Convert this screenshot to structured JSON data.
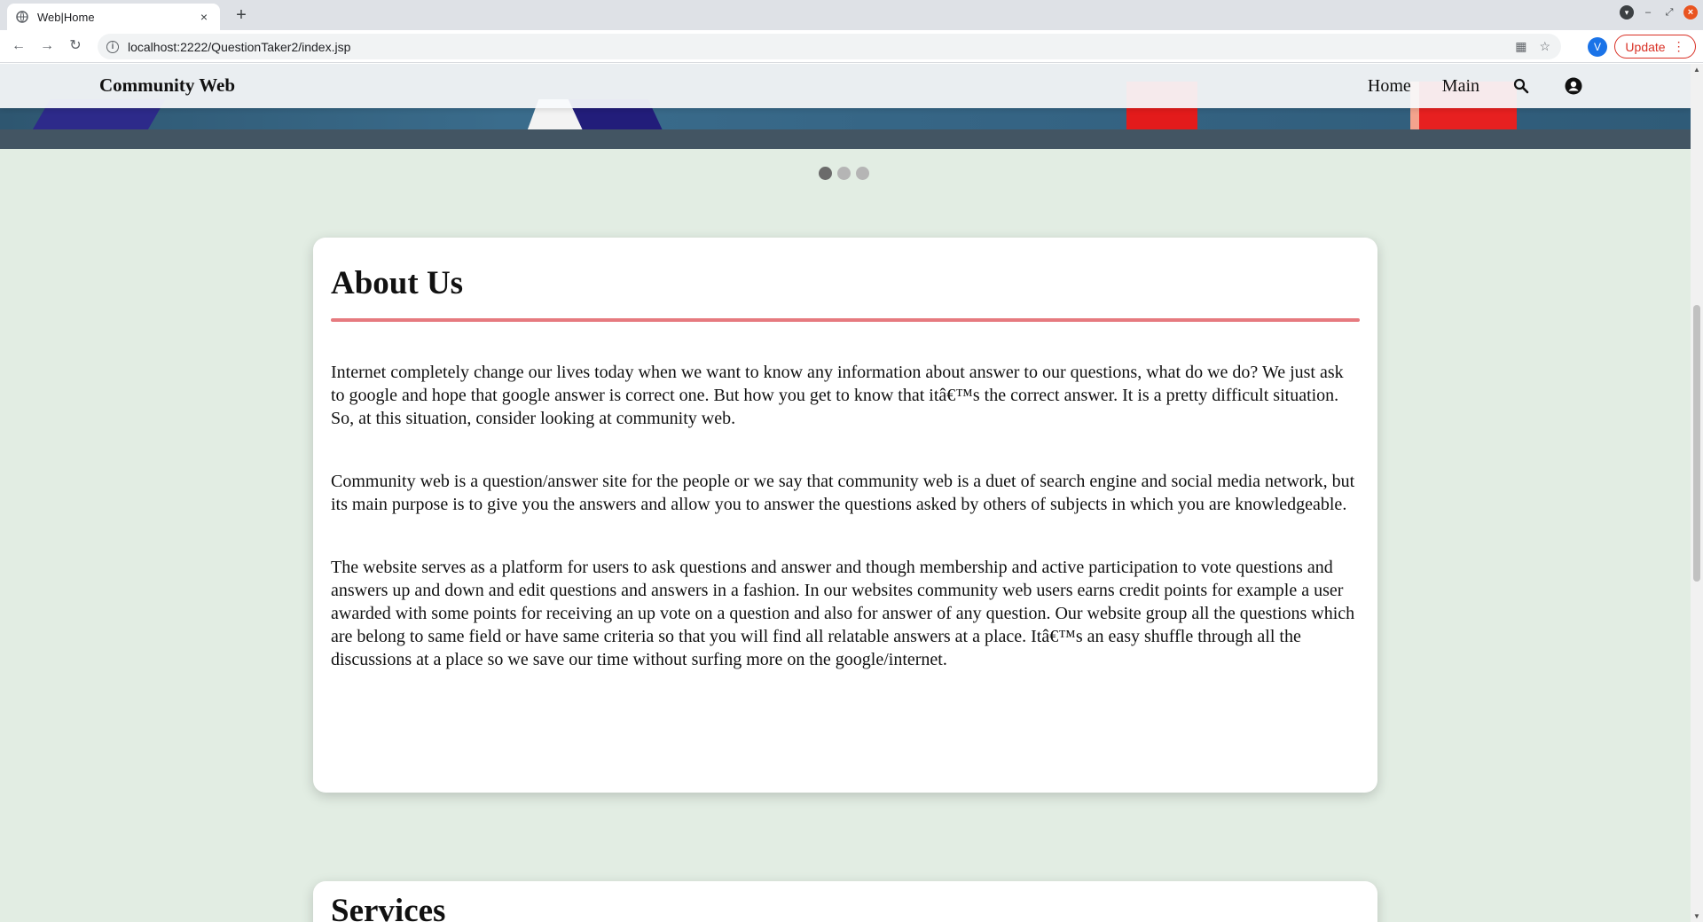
{
  "browser": {
    "tab_title": "Web|Home",
    "tab_close": "×",
    "new_tab": "+",
    "url": "localhost:2222/QuestionTaker2/index.jsp",
    "profile_initial": "V",
    "update_label": "Update"
  },
  "navbar": {
    "brand": "Community Web",
    "links": [
      "Home",
      "Main"
    ]
  },
  "carousel": {
    "active_index": 0,
    "count": 3
  },
  "about": {
    "title": "About Us",
    "paragraphs": [
      "Internet completely change our lives today when we want to know any information about answer to our questions, what do we do? We just ask to google and hope that google answer is correct one. But how you get to know that itâ€™s the correct answer. It is a pretty difficult situation. So, at this situation, consider looking at community web.",
      "Community web is a question/answer site for the people or we say that community web is a duet of search engine and social media network, but its main purpose is to give you the answers and allow you to answer the questions asked by others of subjects in which you are knowledgeable.",
      "The website serves as a platform for users to ask questions and answer and though membership and active participation to vote questions and answers up and down and edit questions and answers in a fashion. In our websites community web users earns credit points for example a user awarded with some points for receiving an up vote on a question and also for answer of any question. Our website group all the questions which are belong to same field or have same criteria so that you will find all relatable answers at a place. Itâ€™s an easy shuffle through all the discussions at a place so we save our time without surfing more on the google/internet."
    ]
  },
  "services": {
    "title": "Services"
  },
  "colors": {
    "page_bg": "#e2ede3",
    "rule": "#e67a7f",
    "update": "#d93025"
  },
  "icons": [
    "back-arrow-icon",
    "forward-arrow-icon",
    "reload-icon",
    "info-icon",
    "star-icon",
    "search-icon",
    "account-icon"
  ]
}
